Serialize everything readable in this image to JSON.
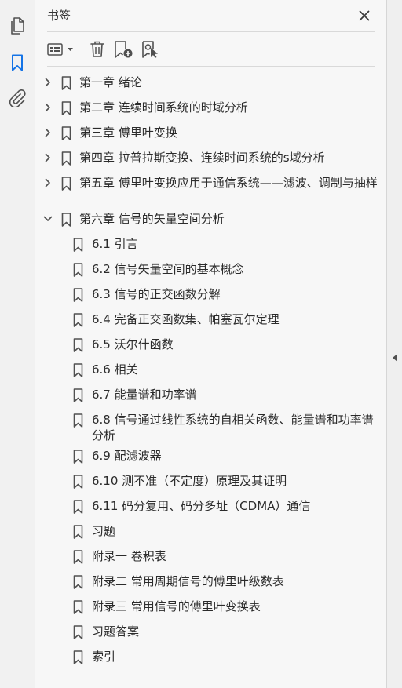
{
  "panel": {
    "title": "书签"
  },
  "rail": {
    "items": [
      {
        "name": "pages-icon"
      },
      {
        "name": "bookmarks-icon",
        "active": true
      },
      {
        "name": "attachments-icon"
      }
    ]
  },
  "toolbar": {
    "options_icon": "list-options-icon",
    "delete_icon": "trash-icon",
    "new_bookmark_icon": "new-bookmark-icon",
    "bookmark_from_selection_icon": "bookmark-select-icon"
  },
  "colors": {
    "accent": "#1473e6",
    "icon": "#505050",
    "text": "#2b2b2b"
  },
  "bookmarks": [
    {
      "label": "第一章  绪论",
      "level": 0,
      "expandable": true,
      "expanded": false
    },
    {
      "label": "第二章  连续时间系统的时域分析",
      "level": 0,
      "expandable": true,
      "expanded": false
    },
    {
      "label": "第三章  傅里叶变换",
      "level": 0,
      "expandable": true,
      "expanded": false
    },
    {
      "label": "第四章  拉普拉斯变换、连续时间系统的s域分析",
      "level": 0,
      "expandable": true,
      "expanded": false
    },
    {
      "label": "第五章  傅里叶变换应用于通信系统——滤波、调制与抽样",
      "level": 0,
      "expandable": true,
      "expanded": false
    },
    {
      "label": "第六章  信号的矢量空间分析",
      "level": 0,
      "expandable": true,
      "expanded": true
    },
    {
      "label": "6.1  引言",
      "level": 1
    },
    {
      "label": "6.2  信号矢量空间的基本概念",
      "level": 1
    },
    {
      "label": "6.3  信号的正交函数分解",
      "level": 1
    },
    {
      "label": "6.4  完备正交函数集、帕塞瓦尔定理",
      "level": 1
    },
    {
      "label": "6.5  沃尔什函数",
      "level": 1
    },
    {
      "label": "6.6  相关",
      "level": 1
    },
    {
      "label": "6.7  能量谱和功率谱",
      "level": 1
    },
    {
      "label": "6.8  信号通过线性系统的自相关函数、能量谱和功率谱分析",
      "level": 1
    },
    {
      "label": "6.9  配滤波器",
      "level": 1
    },
    {
      "label": "6.10  测不准（不定度）原理及其证明",
      "level": 1
    },
    {
      "label": "6.11  码分复用、码分多址（CDMA）通信",
      "level": 1
    },
    {
      "label": "习题",
      "level": 1
    },
    {
      "label": "附录一  卷积表",
      "level": 1
    },
    {
      "label": "附录二  常用周期信号的傅里叶级数表",
      "level": 1
    },
    {
      "label": "附录三  常用信号的傅里叶变换表",
      "level": 1
    },
    {
      "label": "习题答案",
      "level": 1
    },
    {
      "label": "索引",
      "level": 1
    }
  ]
}
